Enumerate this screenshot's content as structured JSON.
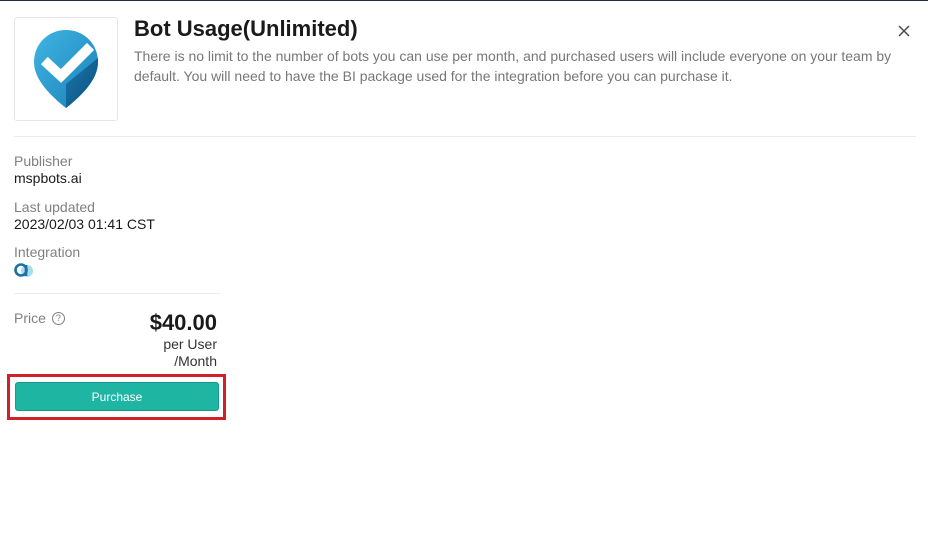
{
  "product": {
    "title": "Bot Usage(Unlimited)",
    "description": "There is no limit to the number of bots you can use per month, and purchased users will include everyone on your team by default. You will need to have the BI package used for the integration before you can purchase it.",
    "logo_icon": "mspbots-shield-check-logo"
  },
  "meta": {
    "publisher_label": "Publisher",
    "publisher_value": "mspbots.ai",
    "updated_label": "Last updated",
    "updated_value": "2023/02/03 01:41 CST",
    "integration_label": "Integration",
    "integration_icon": "bi-integration-icon"
  },
  "pricing": {
    "label": "Price",
    "help_glyph": "?",
    "amount": "$40.00",
    "unit_line1": "per User",
    "unit_line2": "/Month"
  },
  "actions": {
    "purchase_label": "Purchase",
    "close_icon": "close-icon"
  },
  "colors": {
    "accent": "#1fb5a3",
    "highlight": "#d0202a",
    "logo_light": "#2ea9d8",
    "logo_dark": "#0d5f8f"
  }
}
